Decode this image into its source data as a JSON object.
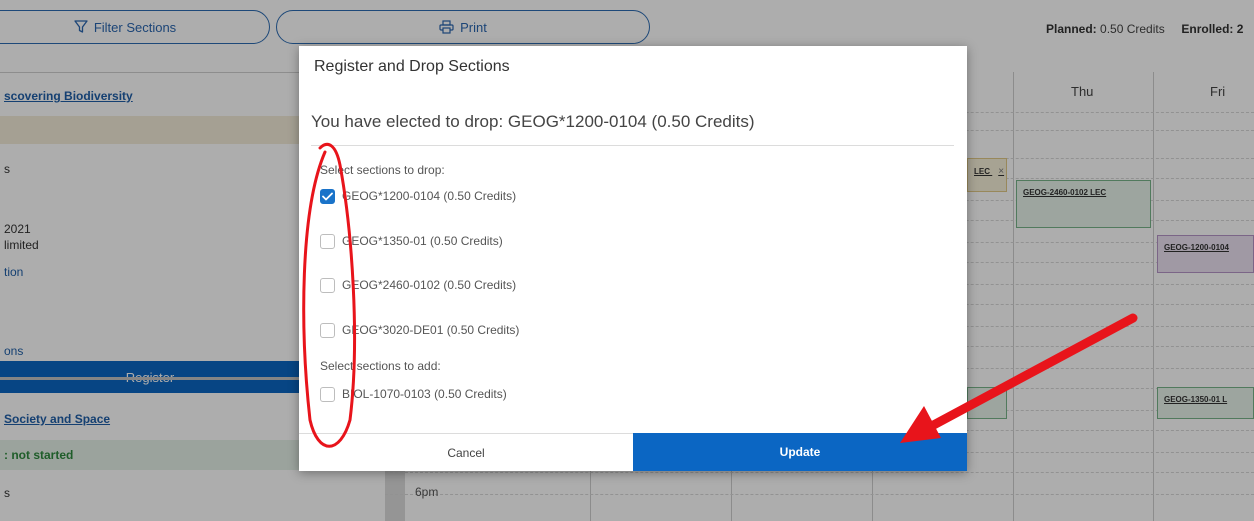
{
  "toolbar": {
    "filter_label": "Filter Sections",
    "print_label": "Print",
    "planned_label": "Planned:",
    "planned_value": "0.50 Credits",
    "enrolled_label": "Enrolled: 2"
  },
  "left_panel": {
    "course1_title": "scovering Biodiversity",
    "course1_s": "s",
    "course1_year": "2021",
    "course1_limited": "limited",
    "course1_link": "tion",
    "register_label": "Register",
    "course1_sections": "ons",
    "course2_title": "Society and Space",
    "course2_status": ": not started",
    "course2_s": "s"
  },
  "calendar": {
    "days": [
      "Thu",
      "Fri"
    ],
    "time_label": "6pm",
    "events": {
      "lec_frag": "LEC",
      "lec_frag_close": "×",
      "geog2460": "GEOG-2460-0102 LEC",
      "geog1200": "GEOG-1200-0104",
      "geog1350": "GEOG-1350-01 L"
    }
  },
  "modal": {
    "title": "Register and Drop Sections",
    "drop_message": "You have elected to drop: GEOG*1200-0104 (0.50 Credits)",
    "drop_heading": "Select sections to drop:",
    "drop_options": [
      {
        "label": "GEOG*1200-0104 (0.50 Credits)",
        "checked": true
      },
      {
        "label": "GEOG*1350-01 (0.50 Credits)",
        "checked": false
      },
      {
        "label": "GEOG*2460-0102 (0.50 Credits)",
        "checked": false
      },
      {
        "label": "GEOG*3020-DE01 (0.50 Credits)",
        "checked": false
      }
    ],
    "add_heading": "Select sections to add:",
    "add_options": [
      {
        "label": "BIOL-1070-0103 (0.50 Credits)",
        "checked": false
      }
    ],
    "cancel_label": "Cancel",
    "update_label": "Update"
  },
  "colors": {
    "primary": "#0b66c3",
    "annotation": "#e8141b",
    "check": "#1a73c9"
  }
}
